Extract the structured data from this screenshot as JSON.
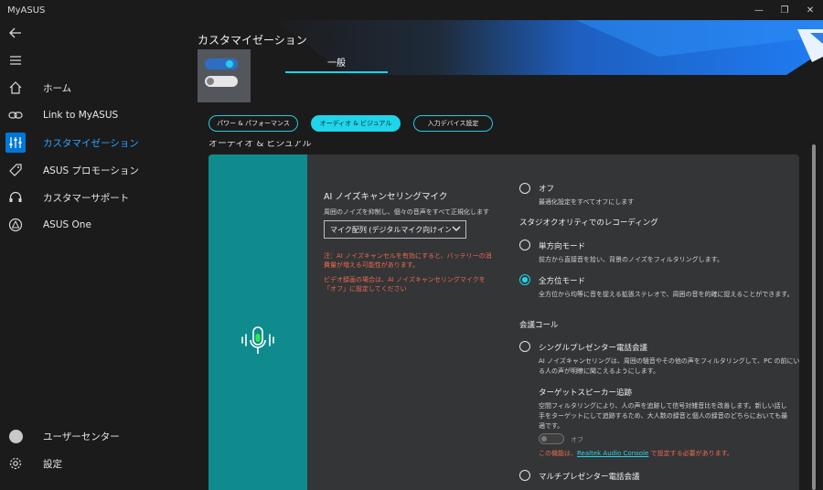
{
  "window": {
    "title": "MyASUS",
    "minimize": "—",
    "maximize": "❐",
    "close": "✕"
  },
  "sidebar": {
    "items": [
      {
        "label": "ホーム",
        "icon": "home-icon"
      },
      {
        "label": "Link to MyASUS",
        "icon": "link-icon"
      },
      {
        "label": "カスタマイゼーション",
        "icon": "sliders-icon",
        "active": true
      },
      {
        "label": "ASUS プロモーション",
        "icon": "tag-icon"
      },
      {
        "label": "カスタマーサポート",
        "icon": "headset-icon"
      },
      {
        "label": "ASUS One",
        "icon": "asus-one-icon"
      }
    ],
    "user_center": "ユーザーセンター",
    "settings": "設定"
  },
  "header": {
    "title": "カスタマイゼーション",
    "tab": "一般"
  },
  "subtabs": [
    "パワー & パフォーマンス",
    "オーディオ & ビジュアル",
    "入力デバイス設定"
  ],
  "section_heading": "オーディオ & ビジュアル",
  "noise_cancel": {
    "title": "AI ノイズキャンセリングマイク",
    "desc": "周囲のノイズを抑制し、個々の音声をすべて正規化します",
    "select_value": "マイク配列 (デジタルマイク向けインテル® スマート・サウンド・テクノロジー)",
    "note1": "注：AI ノイズキャンセルを有効にすると、バッテリーの消費量が増える可能性があります。",
    "note2": "ビデオ録画の場合は、AI ノイズキャンセリングマイクを「オフ」に設定してください"
  },
  "options": {
    "off": {
      "label": "オフ",
      "desc": "最適化設定をすべてオフにします"
    },
    "studio_heading": "スタジオクオリティでのレコーディング",
    "single": {
      "label": "単方向モード",
      "desc": "前方から直接音を拾い、背景のノイズをフィルタリングします。"
    },
    "omni": {
      "label": "全方位モード",
      "desc": "全方位から均等に音を捉える拡張ステレオで、周囲の音を的確に捉えることができます。"
    },
    "conference_heading": "会議コール",
    "single_presenter": {
      "label": "シングルプレゼンター電話会議",
      "desc_line1": "AI ノイズキャンセリングは、周囲の騒音やその他の声をフィルタリングして、PC の前にい",
      "desc_line2": "る人の声が明瞭に聞こえるようにします。"
    },
    "target_tracking": {
      "label": "ターゲットスピーカー追跡",
      "desc_line1": "空間フィルタリングにより、人の声を追跡して信号対雑音比を改善します。新しい話し",
      "desc_line2": "手をターゲットにして追跡するため、大人数の録音と個人の録音のどちらにおいても最",
      "desc_line3": "適です。",
      "toggle_label": "オフ",
      "note_prefix": "この機能は、",
      "note_link": "Realtek Audio Console",
      "note_suffix": " で設定する必要があります。"
    },
    "multi_presenter": {
      "label": "マルチプレゼンター電話会議"
    }
  },
  "colors": {
    "accent_cyan": "#20d4ea",
    "teal_panel": "#0f8b8d",
    "nav_active": "#0078d7",
    "warning": "#e86a55"
  }
}
